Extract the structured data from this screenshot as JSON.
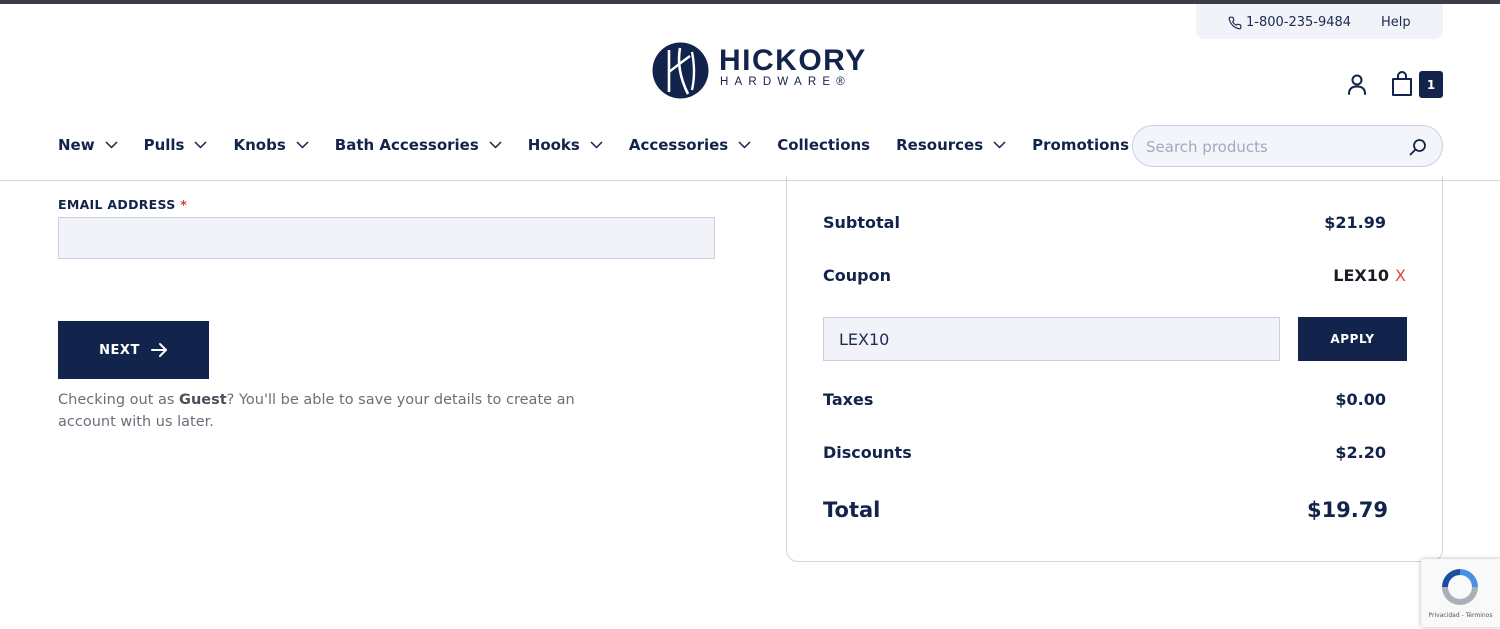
{
  "utility": {
    "phone": "1-800-235-9484",
    "help": "Help"
  },
  "logo": {
    "line1": "HICKORY",
    "line2": "HARDWARE®"
  },
  "cart": {
    "count": "1"
  },
  "nav": {
    "items": [
      {
        "label": "New",
        "dropdown": true
      },
      {
        "label": "Pulls",
        "dropdown": true
      },
      {
        "label": "Knobs",
        "dropdown": true
      },
      {
        "label": "Bath Accessories",
        "dropdown": true
      },
      {
        "label": "Hooks",
        "dropdown": true
      },
      {
        "label": "Accessories",
        "dropdown": true
      },
      {
        "label": "Collections",
        "dropdown": false
      },
      {
        "label": "Resources",
        "dropdown": true
      },
      {
        "label": "Promotions",
        "dropdown": false
      }
    ]
  },
  "search": {
    "placeholder": "Search products"
  },
  "checkout": {
    "email_label": "EMAIL ADDRESS",
    "required_mark": "*",
    "email_value": "",
    "next_label": "NEXT",
    "guest_prefix": "Checking out as ",
    "guest_bold": "Guest",
    "guest_suffix": "? You'll be able to save your details to create an account with us later."
  },
  "summary": {
    "subtotal_label": "Subtotal",
    "subtotal_value": "$21.99",
    "coupon_label": "Coupon",
    "coupon_code": "LEX10",
    "coupon_remove": "X",
    "coupon_input_value": "LEX10",
    "apply_label": "APPLY",
    "taxes_label": "Taxes",
    "taxes_value": "$0.00",
    "discounts_label": "Discounts",
    "discounts_value": "$2.20",
    "total_label": "Total",
    "total_value": "$19.79"
  },
  "recaptcha": {
    "footer": "Privacidad - Términos"
  },
  "colors": {
    "navy": "#12244b",
    "accent_red": "#e0443a",
    "input_bg": "#f2f3f8"
  }
}
